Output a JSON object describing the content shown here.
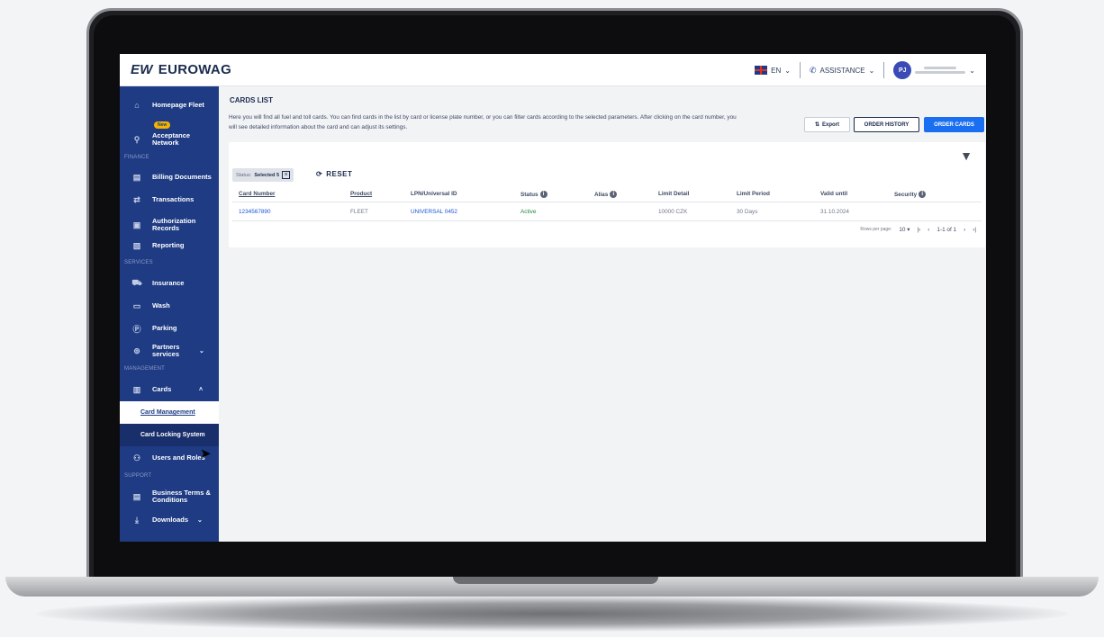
{
  "app": {
    "logo_mark": "EW",
    "logo_text": "EUROWAG"
  },
  "topbar": {
    "language": "EN",
    "assistance": "ASSISTANCE",
    "avatar_initials": "PJ"
  },
  "sidebar": {
    "items": [
      {
        "label": "Homepage Fleet",
        "icon": "home-icon"
      },
      {
        "label": "Acceptance Network",
        "icon": "map-pin-icon",
        "badge": "New"
      },
      {
        "label": "Billing Documents",
        "icon": "document-icon"
      },
      {
        "label": "Transactions",
        "icon": "swap-icon"
      },
      {
        "label": "Authorization Records",
        "icon": "receipt-icon"
      },
      {
        "label": "Reporting",
        "icon": "report-icon"
      },
      {
        "label": "Insurance",
        "icon": "car-insurance-icon"
      },
      {
        "label": "Wash",
        "icon": "wash-icon"
      },
      {
        "label": "Parking",
        "icon": "parking-icon"
      },
      {
        "label": "Partners services",
        "icon": "handshake-icon"
      },
      {
        "label": "Cards",
        "icon": "cards-icon"
      },
      {
        "label": "Users and Roles",
        "icon": "users-icon"
      },
      {
        "label": "Business Terms & Conditions",
        "icon": "terms-icon"
      },
      {
        "label": "Downloads",
        "icon": "download-icon"
      }
    ],
    "sections": {
      "finance": "FINANCE",
      "services": "SERVICES",
      "management": "MANAGEMENT",
      "support": "SUPPORT"
    },
    "sub_items": {
      "card_management": "Card Management",
      "card_locking": "Card Locking System"
    }
  },
  "main": {
    "title": "CARDS LIST",
    "description": "Here you will find all fuel and toll cards. You can find cards in the list by card or license plate number, or you can filter cards according to the selected parameters. After clicking on the card number, you will see detailed information about the card and can adjust its settings.",
    "buttons": {
      "export": "Export",
      "order_history": "ORDER HISTORY",
      "order_cards": "ORDER CARDS"
    },
    "filter_chip": {
      "prefix": "Status:",
      "value": "Selected 5"
    },
    "reset_label": "RESET",
    "table": {
      "headers": [
        "Card Number",
        "Product",
        "LPN/Universal ID",
        "Status",
        "Alias",
        "Limit Detail",
        "Limit Period",
        "Valid until",
        "Security"
      ],
      "rows": [
        {
          "card_number": "1234567890",
          "product": "FLEET",
          "lpn": "UNIVERSAL 0452",
          "status": "Active",
          "alias": "",
          "limit_detail": "10000 CZK",
          "limit_period": "30 Days",
          "valid_until": "31.10.2024",
          "security": ""
        }
      ]
    },
    "pager": {
      "rows_per_page_label": "Rows per page:",
      "rows_per_page": "10",
      "range": "1-1 of 1"
    }
  }
}
